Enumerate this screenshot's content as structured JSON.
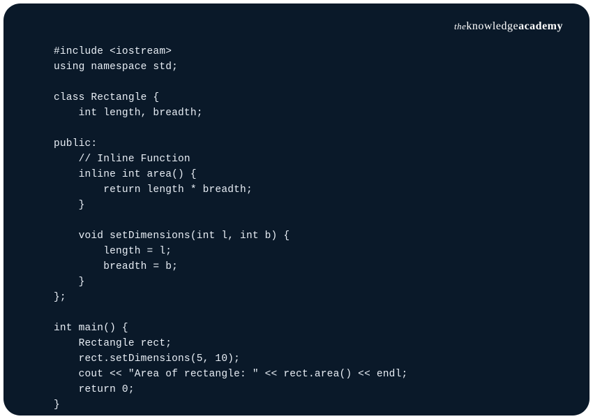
{
  "logo": {
    "the": "the",
    "knowledge": "knowledge",
    "academy": "academy"
  },
  "code": {
    "lines": [
      "#include <iostream>",
      "using namespace std;",
      "",
      "class Rectangle {",
      "    int length, breadth;",
      "",
      "public:",
      "    // Inline Function",
      "    inline int area() {",
      "        return length * breadth;",
      "    }",
      "",
      "    void setDimensions(int l, int b) {",
      "        length = l;",
      "        breadth = b;",
      "    }",
      "};",
      "",
      "int main() {",
      "    Rectangle rect;",
      "    rect.setDimensions(5, 10);",
      "    cout << \"Area of rectangle: \" << rect.area() << endl;",
      "    return 0;",
      "}"
    ]
  }
}
